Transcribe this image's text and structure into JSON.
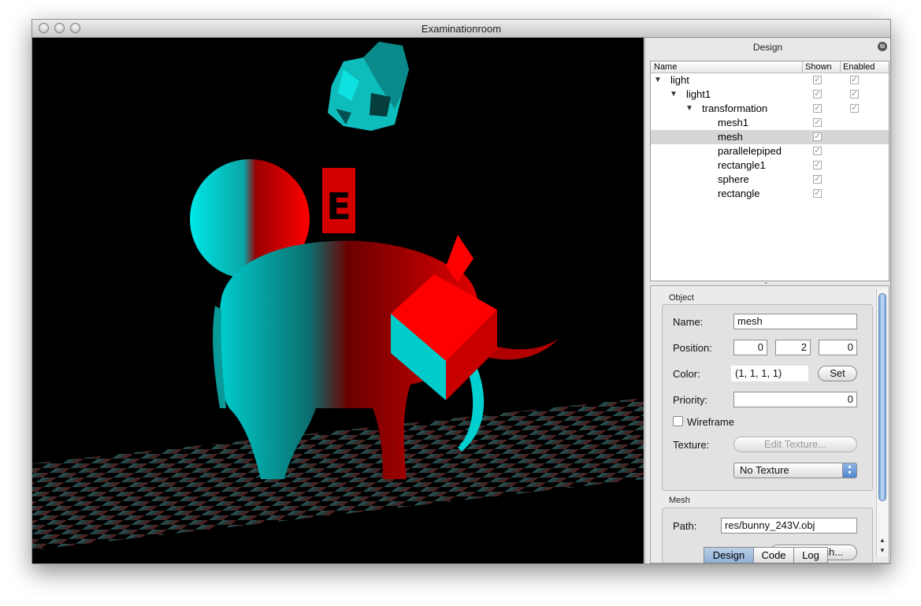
{
  "window": {
    "title": "Examinationroom"
  },
  "viewport": {
    "scene_label": "E"
  },
  "panel": {
    "header": "Design",
    "tree": {
      "columns": [
        "Name",
        "Shown",
        "Enabled"
      ],
      "rows": [
        {
          "label": "light",
          "depth": 0,
          "expanded": true,
          "shown": true,
          "enabled": true
        },
        {
          "label": "light1",
          "depth": 1,
          "expanded": true,
          "shown": true,
          "enabled": true
        },
        {
          "label": "transformation",
          "depth": 2,
          "expanded": true,
          "shown": true,
          "enabled": true
        },
        {
          "label": "mesh1",
          "depth": 3,
          "shown": true
        },
        {
          "label": "mesh",
          "depth": 3,
          "shown": true,
          "selected": true
        },
        {
          "label": "parallelepiped",
          "depth": 3,
          "shown": true
        },
        {
          "label": "rectangle1",
          "depth": 3,
          "shown": true
        },
        {
          "label": "sphere",
          "depth": 3,
          "shown": true
        },
        {
          "label": "rectangle",
          "depth": 3,
          "shown": true
        }
      ]
    },
    "object": {
      "title": "Object",
      "name_label": "Name:",
      "name_value": "mesh",
      "position_label": "Position:",
      "position_x": "0",
      "position_y": "2",
      "position_z": "0",
      "color_label": "Color:",
      "color_value": "(1, 1, 1, 1)",
      "set_button": "Set",
      "priority_label": "Priority:",
      "priority_value": "0",
      "wireframe_label": "Wireframe",
      "wireframe_checked": false,
      "texture_label": "Texture:",
      "edit_texture_button": "Edit Texture...",
      "texture_select": "No Texture"
    },
    "mesh": {
      "title": "Mesh",
      "path_label": "Path:",
      "path_value": "res/bunny_243V.obj",
      "load_button": "Load Mesh..."
    },
    "tabs": [
      "Design",
      "Code",
      "Log"
    ],
    "active_tab": "Design"
  },
  "colors": {
    "cyan": "#00e0e0",
    "red": "#e00000",
    "selection": "#d6d6d6",
    "tab_active": "#9fbbdd"
  }
}
